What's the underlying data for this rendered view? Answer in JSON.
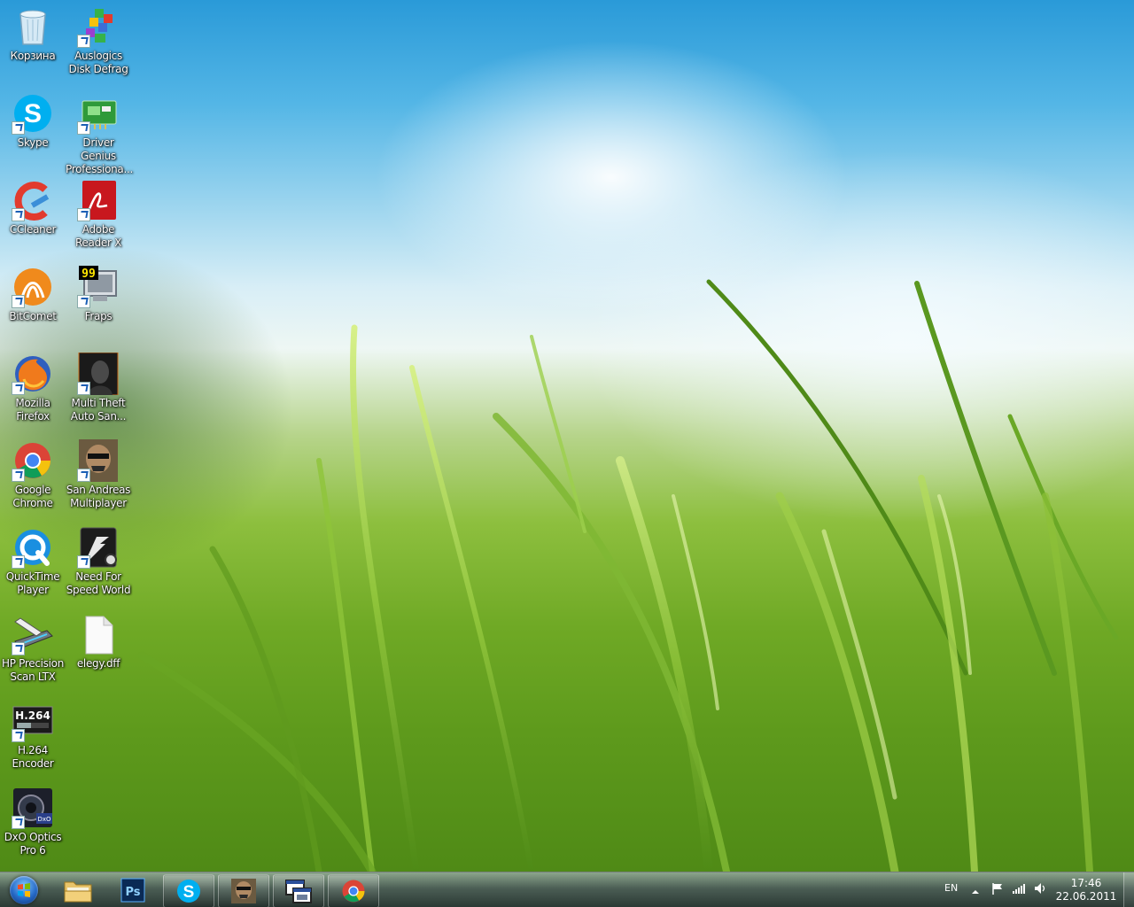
{
  "desktop": {
    "icons": [
      {
        "id": "recycle-bin",
        "label": "Корзина",
        "icon": "recycle-bin-icon"
      },
      {
        "id": "auslogics",
        "label": "Auslogics Disk Defrag",
        "icon": "auslogics-icon"
      },
      {
        "id": "skype",
        "label": "Skype",
        "icon": "skype-icon"
      },
      {
        "id": "driver-genius",
        "label": "Driver Genius Professiona...",
        "icon": "driver-genius-icon"
      },
      {
        "id": "ccleaner",
        "label": "CCleaner",
        "icon": "ccleaner-icon"
      },
      {
        "id": "adobe-reader",
        "label": "Adobe Reader X",
        "icon": "adobe-reader-icon"
      },
      {
        "id": "bitcomet",
        "label": "BitComet",
        "icon": "bitcomet-icon"
      },
      {
        "id": "fraps",
        "label": "Fraps",
        "icon": "fraps-icon",
        "badge": "99"
      },
      {
        "id": "firefox",
        "label": "Mozilla Firefox",
        "icon": "firefox-icon"
      },
      {
        "id": "mta",
        "label": "Multi Theft Auto San...",
        "icon": "mta-icon"
      },
      {
        "id": "chrome",
        "label": "Google Chrome",
        "icon": "chrome-icon"
      },
      {
        "id": "samp",
        "label": "San Andreas Multiplayer",
        "icon": "samp-icon"
      },
      {
        "id": "quicktime",
        "label": "QuickTime Player",
        "icon": "quicktime-icon"
      },
      {
        "id": "nfs-world",
        "label": "Need For Speed World",
        "icon": "nfs-world-icon"
      },
      {
        "id": "hp-scan",
        "label": "HP Precision Scan LTX",
        "icon": "scanner-icon"
      },
      {
        "id": "elegy",
        "label": "elegy.dff",
        "icon": "file-icon"
      },
      {
        "id": "h264",
        "label": "H.264 Encoder",
        "icon": "h264-icon",
        "badge": "H.264"
      },
      {
        "id": "dxo",
        "label": "DxO Optics Pro 6",
        "icon": "dxo-icon",
        "badge": "DxO"
      }
    ]
  },
  "taskbar": {
    "start": {
      "icon": "windows-orb-icon"
    },
    "buttons": [
      {
        "id": "explorer",
        "icon": "folder-icon",
        "open": false
      },
      {
        "id": "photoshop",
        "icon": "photoshop-icon",
        "open": false,
        "text": "Ps"
      },
      {
        "id": "skype",
        "icon": "skype-icon",
        "open": true,
        "text": "S"
      },
      {
        "id": "samp",
        "icon": "samp-icon",
        "open": true
      },
      {
        "id": "app",
        "icon": "window-app-icon",
        "open": true
      },
      {
        "id": "chrome",
        "icon": "chrome-icon",
        "open": true
      }
    ],
    "tray": {
      "language": "EN",
      "icons": [
        "show-hidden-icon",
        "action-center-flag-icon",
        "network-signal-icon",
        "volume-icon"
      ]
    },
    "clock": {
      "time": "17:46",
      "date": "22.06.2011"
    }
  },
  "colors": {
    "taskbar": "#2e4038",
    "skype": "#00aff0",
    "chrome_red": "#db4437",
    "chrome_yellow": "#f4c20d",
    "chrome_green": "#0f9d58",
    "chrome_blue": "#4285f4",
    "photoshop": "#0a2a55"
  }
}
